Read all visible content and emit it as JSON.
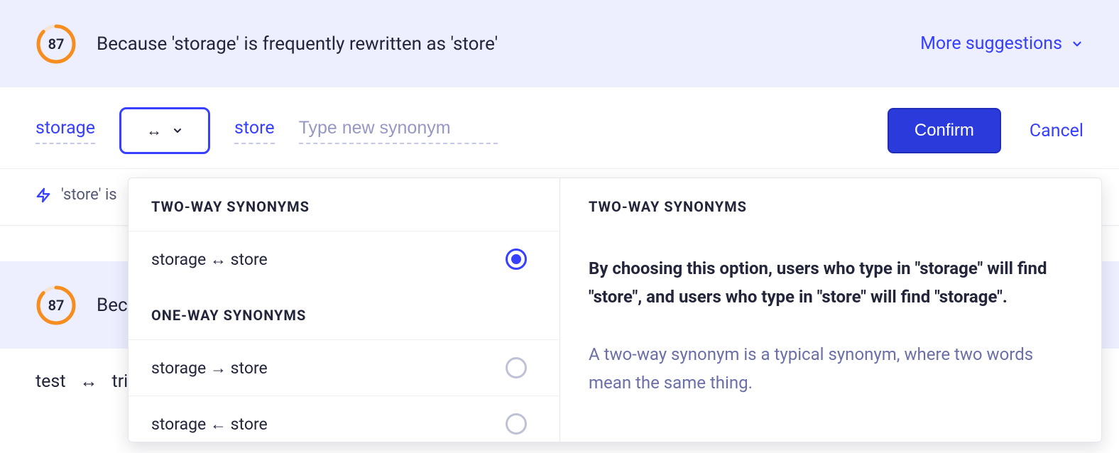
{
  "banner": {
    "score": "87",
    "reason": "Because 'storage' is frequently rewritten as 'store'",
    "more_label": "More suggestions"
  },
  "editor": {
    "term_a": "storage",
    "term_b": "store",
    "direction_glyph": "↔",
    "new_synonym_placeholder": "Type new synonym",
    "confirm_label": "Confirm",
    "cancel_label": "Cancel"
  },
  "info_row": {
    "text_partial": "'store' is"
  },
  "card2": {
    "score": "87",
    "reason_partial": "Beca"
  },
  "existing": {
    "term_a": "test",
    "glyph": "↔",
    "term_b_partial": "tri"
  },
  "dropdown": {
    "left": {
      "section_two_way": "TWO-WAY SYNONYMS",
      "section_one_way": "ONE-WAY SYNONYMS",
      "options": [
        {
          "label": "storage ↔ store",
          "selected": true
        },
        {
          "label": "storage → store",
          "selected": false
        },
        {
          "label": "storage ← store",
          "selected": false
        }
      ]
    },
    "right": {
      "title": "TWO-WAY SYNONYMS",
      "desc": "By choosing this option, users who type in \"storage\" will find \"store\", and users who type in \"store\" will find \"storage\".",
      "note": "A two-way synonym is a typical synonym, where two words mean the same thing."
    }
  }
}
